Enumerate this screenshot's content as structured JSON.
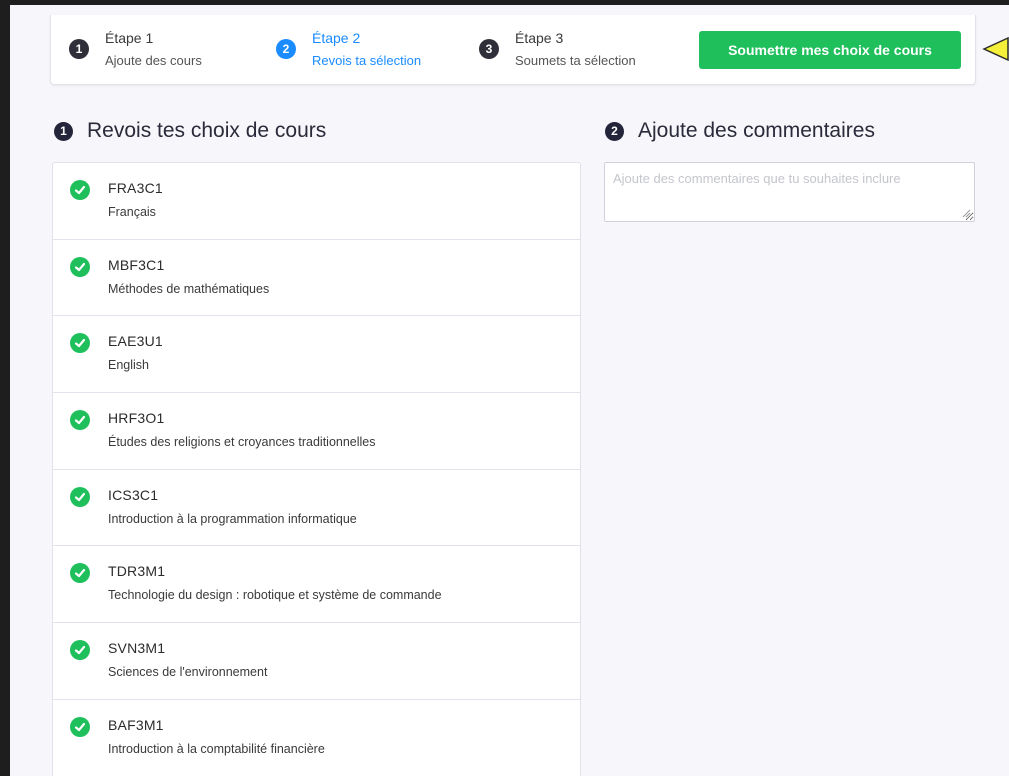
{
  "stepper": {
    "steps": [
      {
        "number": "1",
        "title": "Étape 1",
        "subtitle": "Ajoute des cours",
        "active": false
      },
      {
        "number": "2",
        "title": "Étape 2",
        "subtitle": "Revois ta sélection",
        "active": true
      },
      {
        "number": "3",
        "title": "Étape 3",
        "subtitle": "Soumets ta sélection",
        "active": false
      }
    ],
    "submit_label": "Soumettre mes choix de cours",
    "active_color": "#1a8cff",
    "submit_color": "#1fbf5c"
  },
  "review": {
    "number": "1",
    "heading": "Revois tes choix de cours",
    "courses": [
      {
        "code": "FRA3C1",
        "name": "Français"
      },
      {
        "code": "MBF3C1",
        "name": "Méthodes de mathématiques"
      },
      {
        "code": "EAE3U1",
        "name": "English"
      },
      {
        "code": "HRF3O1",
        "name": "Études des religions et croyances traditionnelles"
      },
      {
        "code": "ICS3C1",
        "name": "Introduction à la programmation informatique"
      },
      {
        "code": "TDR3M1",
        "name": "Technologie du design : robotique et système de commande"
      },
      {
        "code": "SVN3M1",
        "name": "Sciences de l'environnement"
      },
      {
        "code": "BAF3M1",
        "name": "Introduction à la comptabilité financière"
      }
    ],
    "check_icon": "check-circle-icon"
  },
  "comments": {
    "number": "2",
    "heading": "Ajoute des commentaires",
    "placeholder": "Ajoute des commentaires que tu souhaites inclure",
    "value": ""
  },
  "annotation": {
    "icon": "arrow-pointer-icon",
    "color": "#f5f03a"
  }
}
